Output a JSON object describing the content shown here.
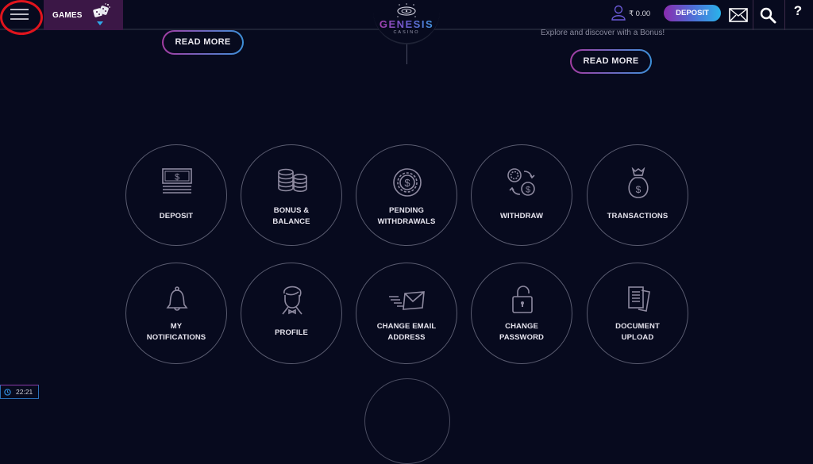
{
  "header": {
    "menu_icon": "hamburger-menu-icon",
    "games_label": "GAMES",
    "games_icon": "dice-icon",
    "logo_title": "GENESIS",
    "logo_subtitle": "CASINO",
    "balance": "₹ 0.00",
    "deposit_label": "DEPOSIT",
    "icons": [
      "user-icon",
      "mail-icon",
      "search-icon",
      "help-icon"
    ],
    "help_glyph": "?"
  },
  "banners": {
    "left_read_more": "READ MORE",
    "right_tagline": "Explore and discover with a Bonus!",
    "right_read_more": "READ MORE"
  },
  "tiles": [
    {
      "label_lines": [
        "DEPOSIT"
      ],
      "icon": "cash-icon"
    },
    {
      "label_lines": [
        "BONUS &",
        "BALANCE"
      ],
      "icon": "coins-icon"
    },
    {
      "label_lines": [
        "PENDING",
        "WITHDRAWALS"
      ],
      "icon": "chip-dollar-icon"
    },
    {
      "label_lines": [
        "WITHDRAW"
      ],
      "icon": "exchange-icon"
    },
    {
      "label_lines": [
        "TRANSACTIONS"
      ],
      "icon": "money-bag-icon"
    },
    {
      "label_lines": [
        "MY",
        "NOTIFICATIONS"
      ],
      "icon": "bell-icon"
    },
    {
      "label_lines": [
        "PROFILE"
      ],
      "icon": "person-icon"
    },
    {
      "label_lines": [
        "CHANGE EMAIL",
        "ADDRESS"
      ],
      "icon": "send-mail-icon"
    },
    {
      "label_lines": [
        "CHANGE",
        "PASSWORD"
      ],
      "icon": "unlock-icon"
    },
    {
      "label_lines": [
        "DOCUMENT",
        "UPLOAD"
      ],
      "icon": "documents-icon"
    }
  ],
  "clock": {
    "time": "22:21"
  },
  "colors": {
    "background": "#070a1e",
    "games_tab": "#3b1746",
    "accent_pink": "#a23da2",
    "accent_blue": "#2ab3ea",
    "highlight": "#e0141d"
  }
}
